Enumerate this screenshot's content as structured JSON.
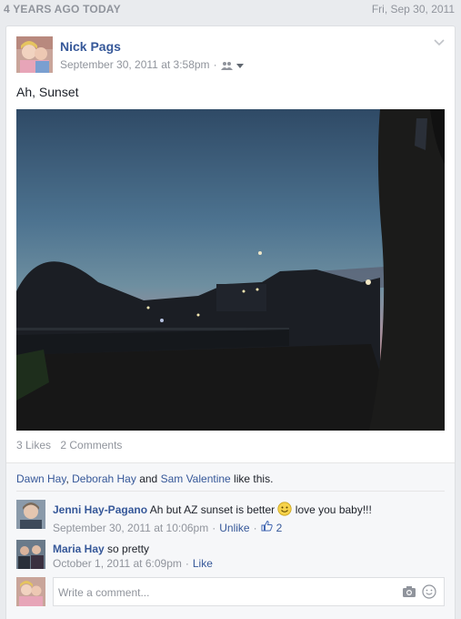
{
  "memory": {
    "label": "4 YEARS AGO TODAY",
    "date": "Fri, Sep 30, 2011"
  },
  "post": {
    "author": "Nick Pags",
    "timestamp": "September 30, 2011 at 3:58pm",
    "separator": "·",
    "text": "Ah, Sunset",
    "likes": "3 Likes",
    "comments_count": "2 Comments"
  },
  "likers": {
    "names": [
      "Dawn Hay",
      "Deborah Hay",
      "Sam Valentine"
    ],
    "sep1": ", ",
    "and": " and ",
    "suffix": " like this."
  },
  "comments": [
    {
      "author": "Jenni Hay-Pagano",
      "text_before": " Ah but AZ sunset is better ",
      "text_after": " love you baby!!!",
      "timestamp": "September 30, 2011 at 10:06pm",
      "action": "Unlike",
      "like_count": "2"
    },
    {
      "author": "Maria Hay",
      "text": " so pretty",
      "timestamp": "October 1, 2011 at 6:09pm",
      "action": "Like"
    }
  ],
  "composer": {
    "placeholder": "Write a comment..."
  },
  "icons": [
    "audience-friends-icon",
    "chevron-down-icon",
    "smiley-icon",
    "thumbs-up-icon",
    "camera-icon",
    "emoji-icon"
  ],
  "colors": {
    "link": "#365899",
    "meta": "#90949c",
    "background": "#e9ebee"
  }
}
